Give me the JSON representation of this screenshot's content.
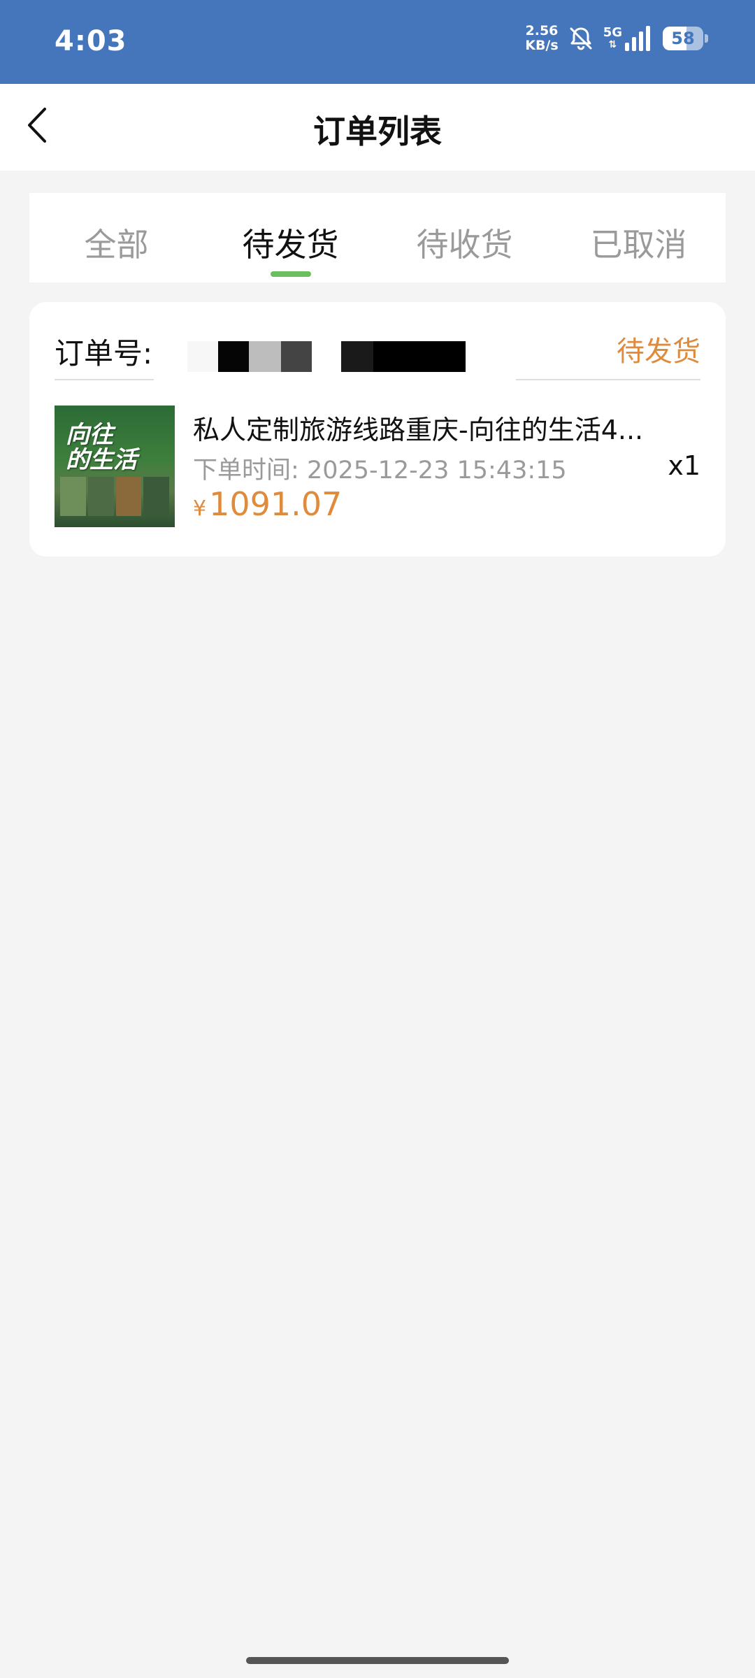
{
  "status_bar": {
    "time": "4:03",
    "speed_value": "2.56",
    "speed_unit": "KB/s",
    "network": "5G",
    "battery": "58",
    "icons": [
      "bell-muted-icon",
      "signal-icon",
      "battery-icon"
    ]
  },
  "header": {
    "title": "订单列表",
    "back_icon": "chevron-left-icon"
  },
  "tabs": [
    {
      "label": "全部",
      "active": false
    },
    {
      "label": "待发货",
      "active": true
    },
    {
      "label": "待收货",
      "active": false
    },
    {
      "label": "已取消",
      "active": false
    }
  ],
  "order": {
    "number_label": "订单号:",
    "status": "待发货",
    "product": {
      "name": "私人定制旅游线路重庆-向往的生活4...",
      "thumb_text_line1": "向往",
      "thumb_text_line2": "的生活"
    },
    "time_label": "下单时间:",
    "time_value": "2025-12-23 15:43:15",
    "quantity": "x1",
    "currency": "¥",
    "price": "1091.07"
  },
  "colors": {
    "status_bar": "#4576bc",
    "accent_orange": "#e08a3c",
    "tab_indicator": "#6cbf5e",
    "background": "#f4f4f4"
  }
}
